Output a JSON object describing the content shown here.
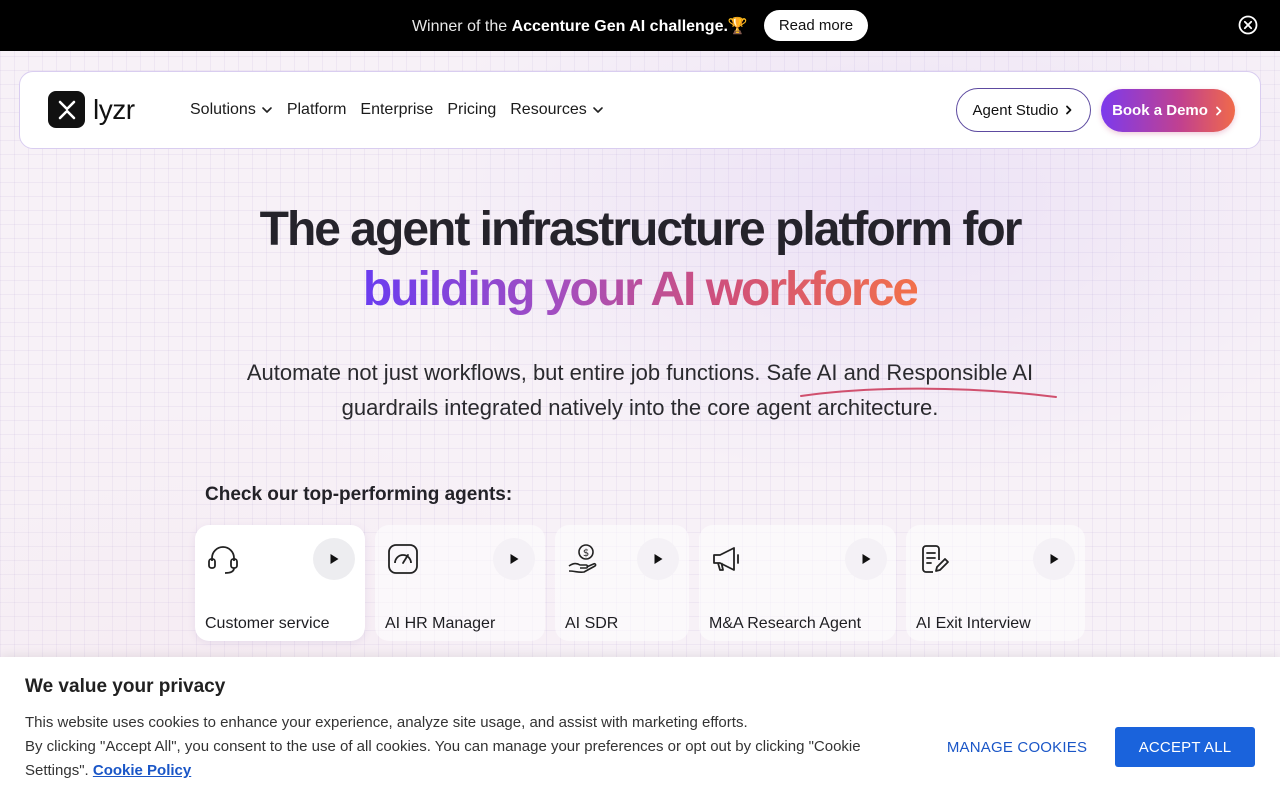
{
  "announcement": {
    "prefix": "Winner of the ",
    "highlight": "Accenture Gen AI challenge.",
    "emoji": "🏆",
    "button_label": "Read more"
  },
  "nav": {
    "logo_text": "lyzr",
    "links": [
      {
        "label": "Solutions",
        "has_dropdown": true
      },
      {
        "label": "Platform",
        "has_dropdown": false
      },
      {
        "label": "Enterprise",
        "has_dropdown": false
      },
      {
        "label": "Pricing",
        "has_dropdown": false
      },
      {
        "label": "Resources",
        "has_dropdown": true
      }
    ],
    "studio_label": "Agent Studio",
    "demo_label": "Book a Demo"
  },
  "hero": {
    "title_line1": "The agent infrastructure platform for",
    "title_line2": "building your AI workforce",
    "subtitle_part1": "Automate not just workflows, but entire job functions. Safe AI and Responsible AI",
    "subtitle_part2": "guardrails integrated natively into the core agent architecture."
  },
  "agents": {
    "heading": "Check our top-performing agents:",
    "items": [
      {
        "label": "Customer service",
        "icon": "headset-icon",
        "active": true
      },
      {
        "label": "AI HR Manager",
        "icon": "gauge-icon",
        "active": false
      },
      {
        "label": "AI SDR",
        "icon": "money-hand-icon",
        "active": false
      },
      {
        "label": "M&A Research Agent",
        "icon": "megaphone-icon",
        "active": false
      },
      {
        "label": "AI Exit Interview",
        "icon": "document-edit-icon",
        "active": false
      }
    ]
  },
  "cookie": {
    "title": "We value your privacy",
    "line1": "This website uses cookies to enhance your experience, analyze site usage, and assist with marketing efforts.",
    "line2": "By clicking \"Accept All\", you consent to the use of all cookies. You can manage your preferences or opt out by clicking \"Cookie Settings\".",
    "link_label": "Cookie Policy",
    "manage_label": "MANAGE COOKIES",
    "accept_label": "ACCEPT ALL"
  },
  "colors": {
    "accent_blue": "#1a63dc",
    "gradient_start": "#6a3cf0",
    "gradient_end": "#f2704a"
  }
}
